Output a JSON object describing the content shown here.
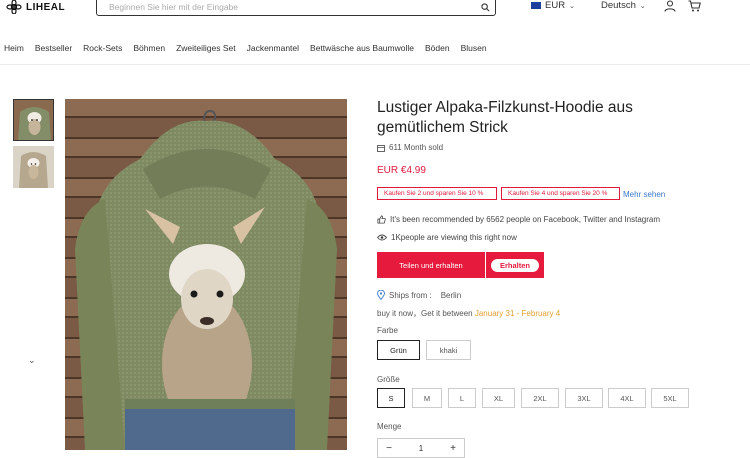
{
  "header": {
    "logo_text": "LIHEAL",
    "search_placeholder": "Beginnen Sie hier mit der Eingabe",
    "currency": "EUR",
    "language": "Deutsch"
  },
  "nav": [
    "Heim",
    "Bestseller",
    "Rock-Sets",
    "Böhmen",
    "Zweiteiliges Set",
    "Jackenmantel",
    "Bettwäsche aus Baumwolle",
    "Böden",
    "Blusen"
  ],
  "product": {
    "title": "Lustiger Alpaka-Filzkunst-Hoodie aus gemütlichem Strick",
    "sold": "611 Month sold",
    "price": "EUR €4.99",
    "discounts": [
      "Kaufen Sie 2 und sparen Sie 10 %",
      "Kaufen Sie 4 und sparen Sie 20 %"
    ],
    "more_link": "Mehr sehen",
    "recommended": "It's been recommended by 6562 people on Facebook, Twitter and Instagram",
    "viewing": "1Kpeople are viewing this right now",
    "share_button": "Teilen und erhalten",
    "get_button": "Erhalten",
    "ships_label": "Ships from :",
    "ships_city": "Berlin",
    "buy_text": "buy it now，Get it between",
    "delivery_dates": "January 31 - February 4",
    "color_label": "Farbe",
    "colors": [
      "Grün",
      "khaki"
    ],
    "selected_color": "Grün",
    "size_label": "Größe",
    "sizes": [
      "S",
      "M",
      "L",
      "XL",
      "2XL",
      "3XL",
      "4XL",
      "5XL"
    ],
    "selected_size": "S",
    "qty_label": "Menge",
    "qty_minus": "−",
    "qty_plus": "+",
    "quantity": "1"
  },
  "colors": {
    "accent": "#e51a3c",
    "link": "#3a78c9",
    "date": "#e0a030"
  },
  "icons": [
    "search-icon",
    "flag-eu-icon",
    "chevron-down-icon",
    "user-icon",
    "cart-icon",
    "box-icon",
    "thumbs-up-icon",
    "eye-icon",
    "location-pin-icon"
  ]
}
